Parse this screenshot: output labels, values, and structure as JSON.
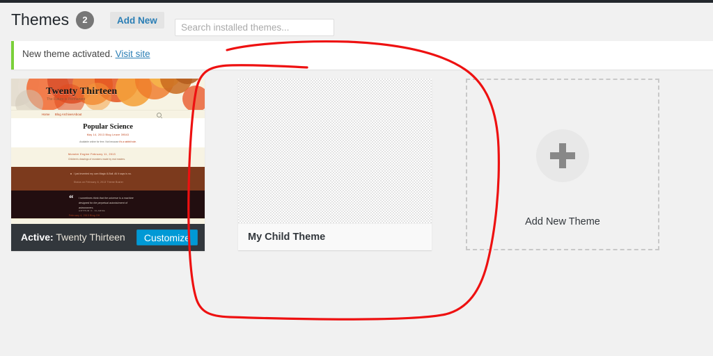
{
  "header": {
    "title": "Themes",
    "count": "2",
    "add_new_label": "Add New",
    "search_placeholder": "Search installed themes...",
    "search_value": ""
  },
  "notice": {
    "text": "New theme activated. ",
    "link_label": "Visit site",
    "accent_color": "#7ad03a"
  },
  "themes": [
    {
      "name": "Twenty Thirteen",
      "active_prefix": "Active:",
      "customize_label": "Customize",
      "screenshot": {
        "site_title": "Twenty Thirteen",
        "tagline": "The Future is Permanent",
        "nav": [
          "Home",
          "Blog Archives",
          "About"
        ],
        "search_icon": "search-icon",
        "post_title": "Popular Science",
        "post_meta": "May 14, 2013    Blog    Leave 39543",
        "post_excerpt": "Available online for free. Not because ",
        "post_excerpt_link": "it's a rabbit hole.",
        "aside_title": "Monster Engine    February 11, 2013",
        "aside_text": "Children's drawings of monsters made by real readers.",
        "status_text": "I just invented my own Magic 8-Ball. All it says is no.",
        "status_meta": "Status on February 6, 2013    Theme Buster",
        "quote_mark": "“",
        "quote_text": "I sometimes think that the universe is a machine designed for the perpetual astonishment of astronomers.",
        "quote_cite": "ARTHUR C. CLARKE",
        "quote_meta": "February 4, 2013    Blog    Off"
      }
    },
    {
      "name": "My Child Theme",
      "screenshot": "none-checkerboard"
    }
  ],
  "add_theme": {
    "label": "Add New Theme",
    "icon": "plus-icon"
  },
  "annotation": {
    "type": "freehand-loop",
    "color": "#ee1111",
    "stroke_width": "3",
    "encircles": "My Child Theme"
  },
  "colors": {
    "page_background": "#f1f1f1",
    "admin_bar": "#23282d",
    "link_blue": "#2a7eb5",
    "customize_blue": "#0099d5",
    "active_bar": "#32373c"
  }
}
